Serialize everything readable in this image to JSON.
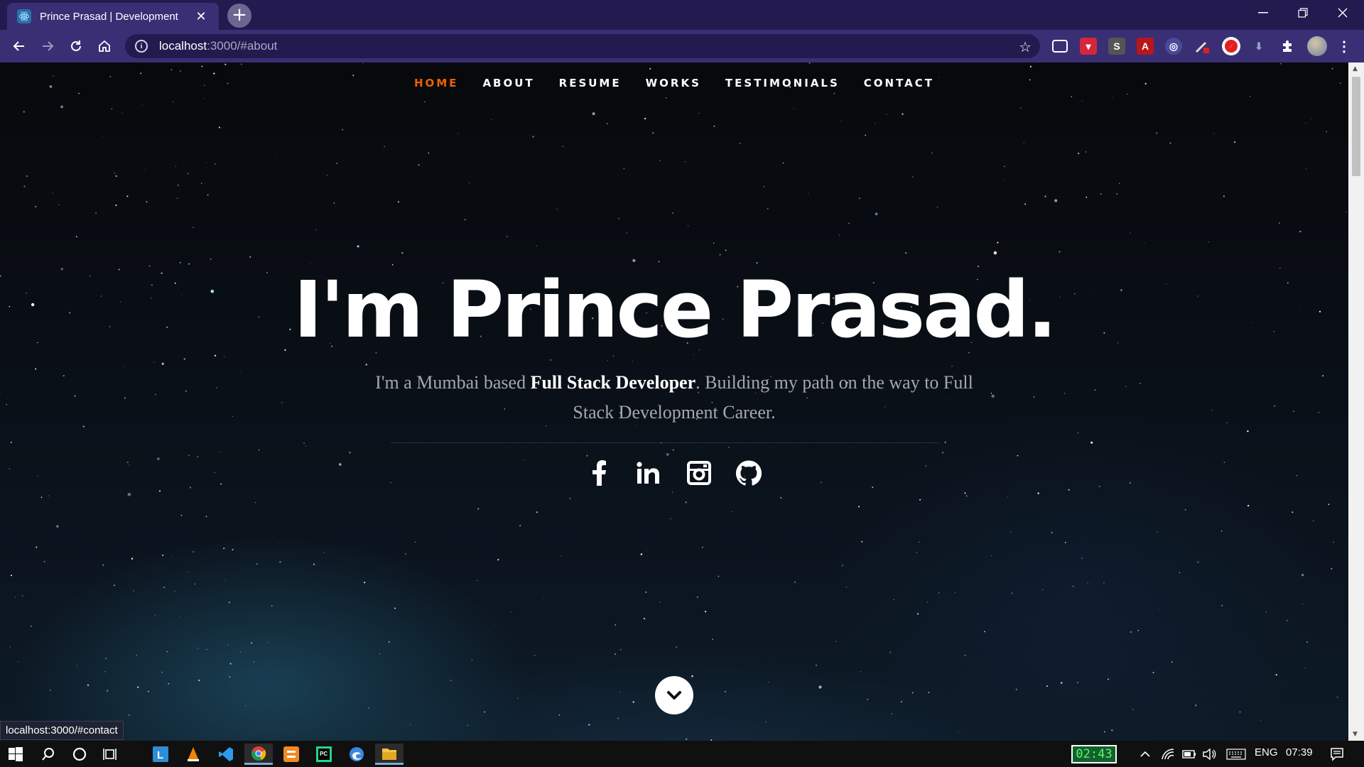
{
  "browser": {
    "tab_title": "Prince Prasad | Development",
    "url_host": "localhost",
    "url_path": ":3000/#about"
  },
  "site": {
    "nav": [
      {
        "label": "HOME",
        "active": true
      },
      {
        "label": "ABOUT",
        "active": false
      },
      {
        "label": "RESUME",
        "active": false
      },
      {
        "label": "WORKS",
        "active": false
      },
      {
        "label": "TESTIMONIALS",
        "active": false
      },
      {
        "label": "CONTACT",
        "active": false
      }
    ],
    "hero_title": "I'm Prince Prasad.",
    "hero_intro": "I'm a Mumbai based ",
    "hero_role": "Full Stack Developer",
    "hero_outro": ". Building my path on the way to Full Stack Development Career.",
    "social_icons": [
      "facebook-icon",
      "linkedin-icon",
      "instagram-icon",
      "github-icon"
    ],
    "accent_color": "#f06000"
  },
  "status_bar": {
    "hover_url": "localhost:3000/#contact"
  },
  "taskbar": {
    "timer": "02:43",
    "language": "ENG",
    "clock": "07:39"
  }
}
